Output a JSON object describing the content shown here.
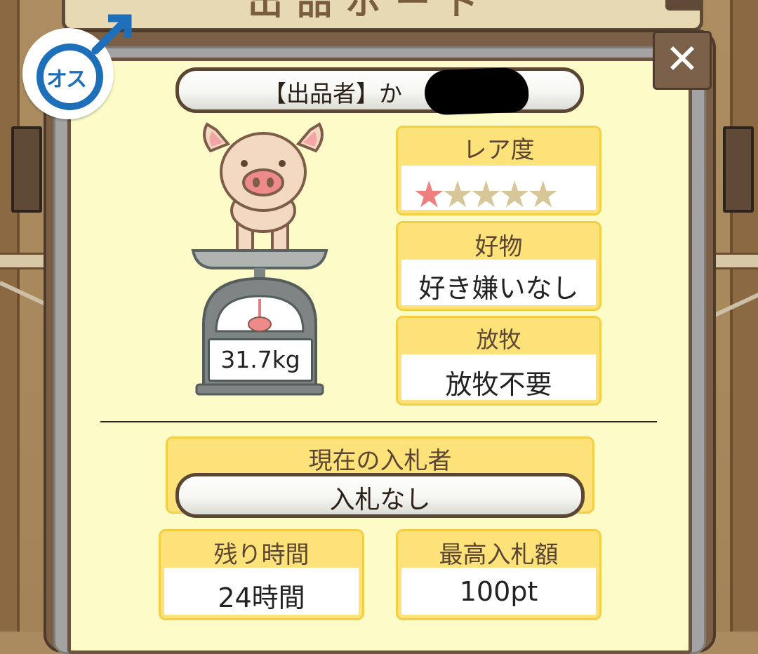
{
  "header": {
    "sign_text": "出品ボード"
  },
  "gender": {
    "label": "オス",
    "symbol": "male-symbol"
  },
  "close_button": {
    "label": "✕"
  },
  "seller": {
    "label": "【出品者】か"
  },
  "pig": {
    "weight": "31.7kg"
  },
  "rarity": {
    "label": "レア度",
    "stars_filled": 1,
    "stars_total": 5,
    "filled_color": "#ef7f7f",
    "empty_color": "#d7c697"
  },
  "favorite": {
    "label": "好物",
    "value": "好き嫌いなし"
  },
  "grazing": {
    "label": "放牧",
    "value": "放牧不要"
  },
  "bidder": {
    "label": "現在の入札者",
    "value": "入札なし"
  },
  "remaining": {
    "label": "残り時間",
    "value": "24時間"
  },
  "max_bid": {
    "label": "最高入札額",
    "value": "100pt"
  },
  "colors": {
    "card_yellow": "#fde27a",
    "panel": "#fdfbc7",
    "wood": "#7b5f44",
    "male_blue": "#1e6fb9"
  }
}
